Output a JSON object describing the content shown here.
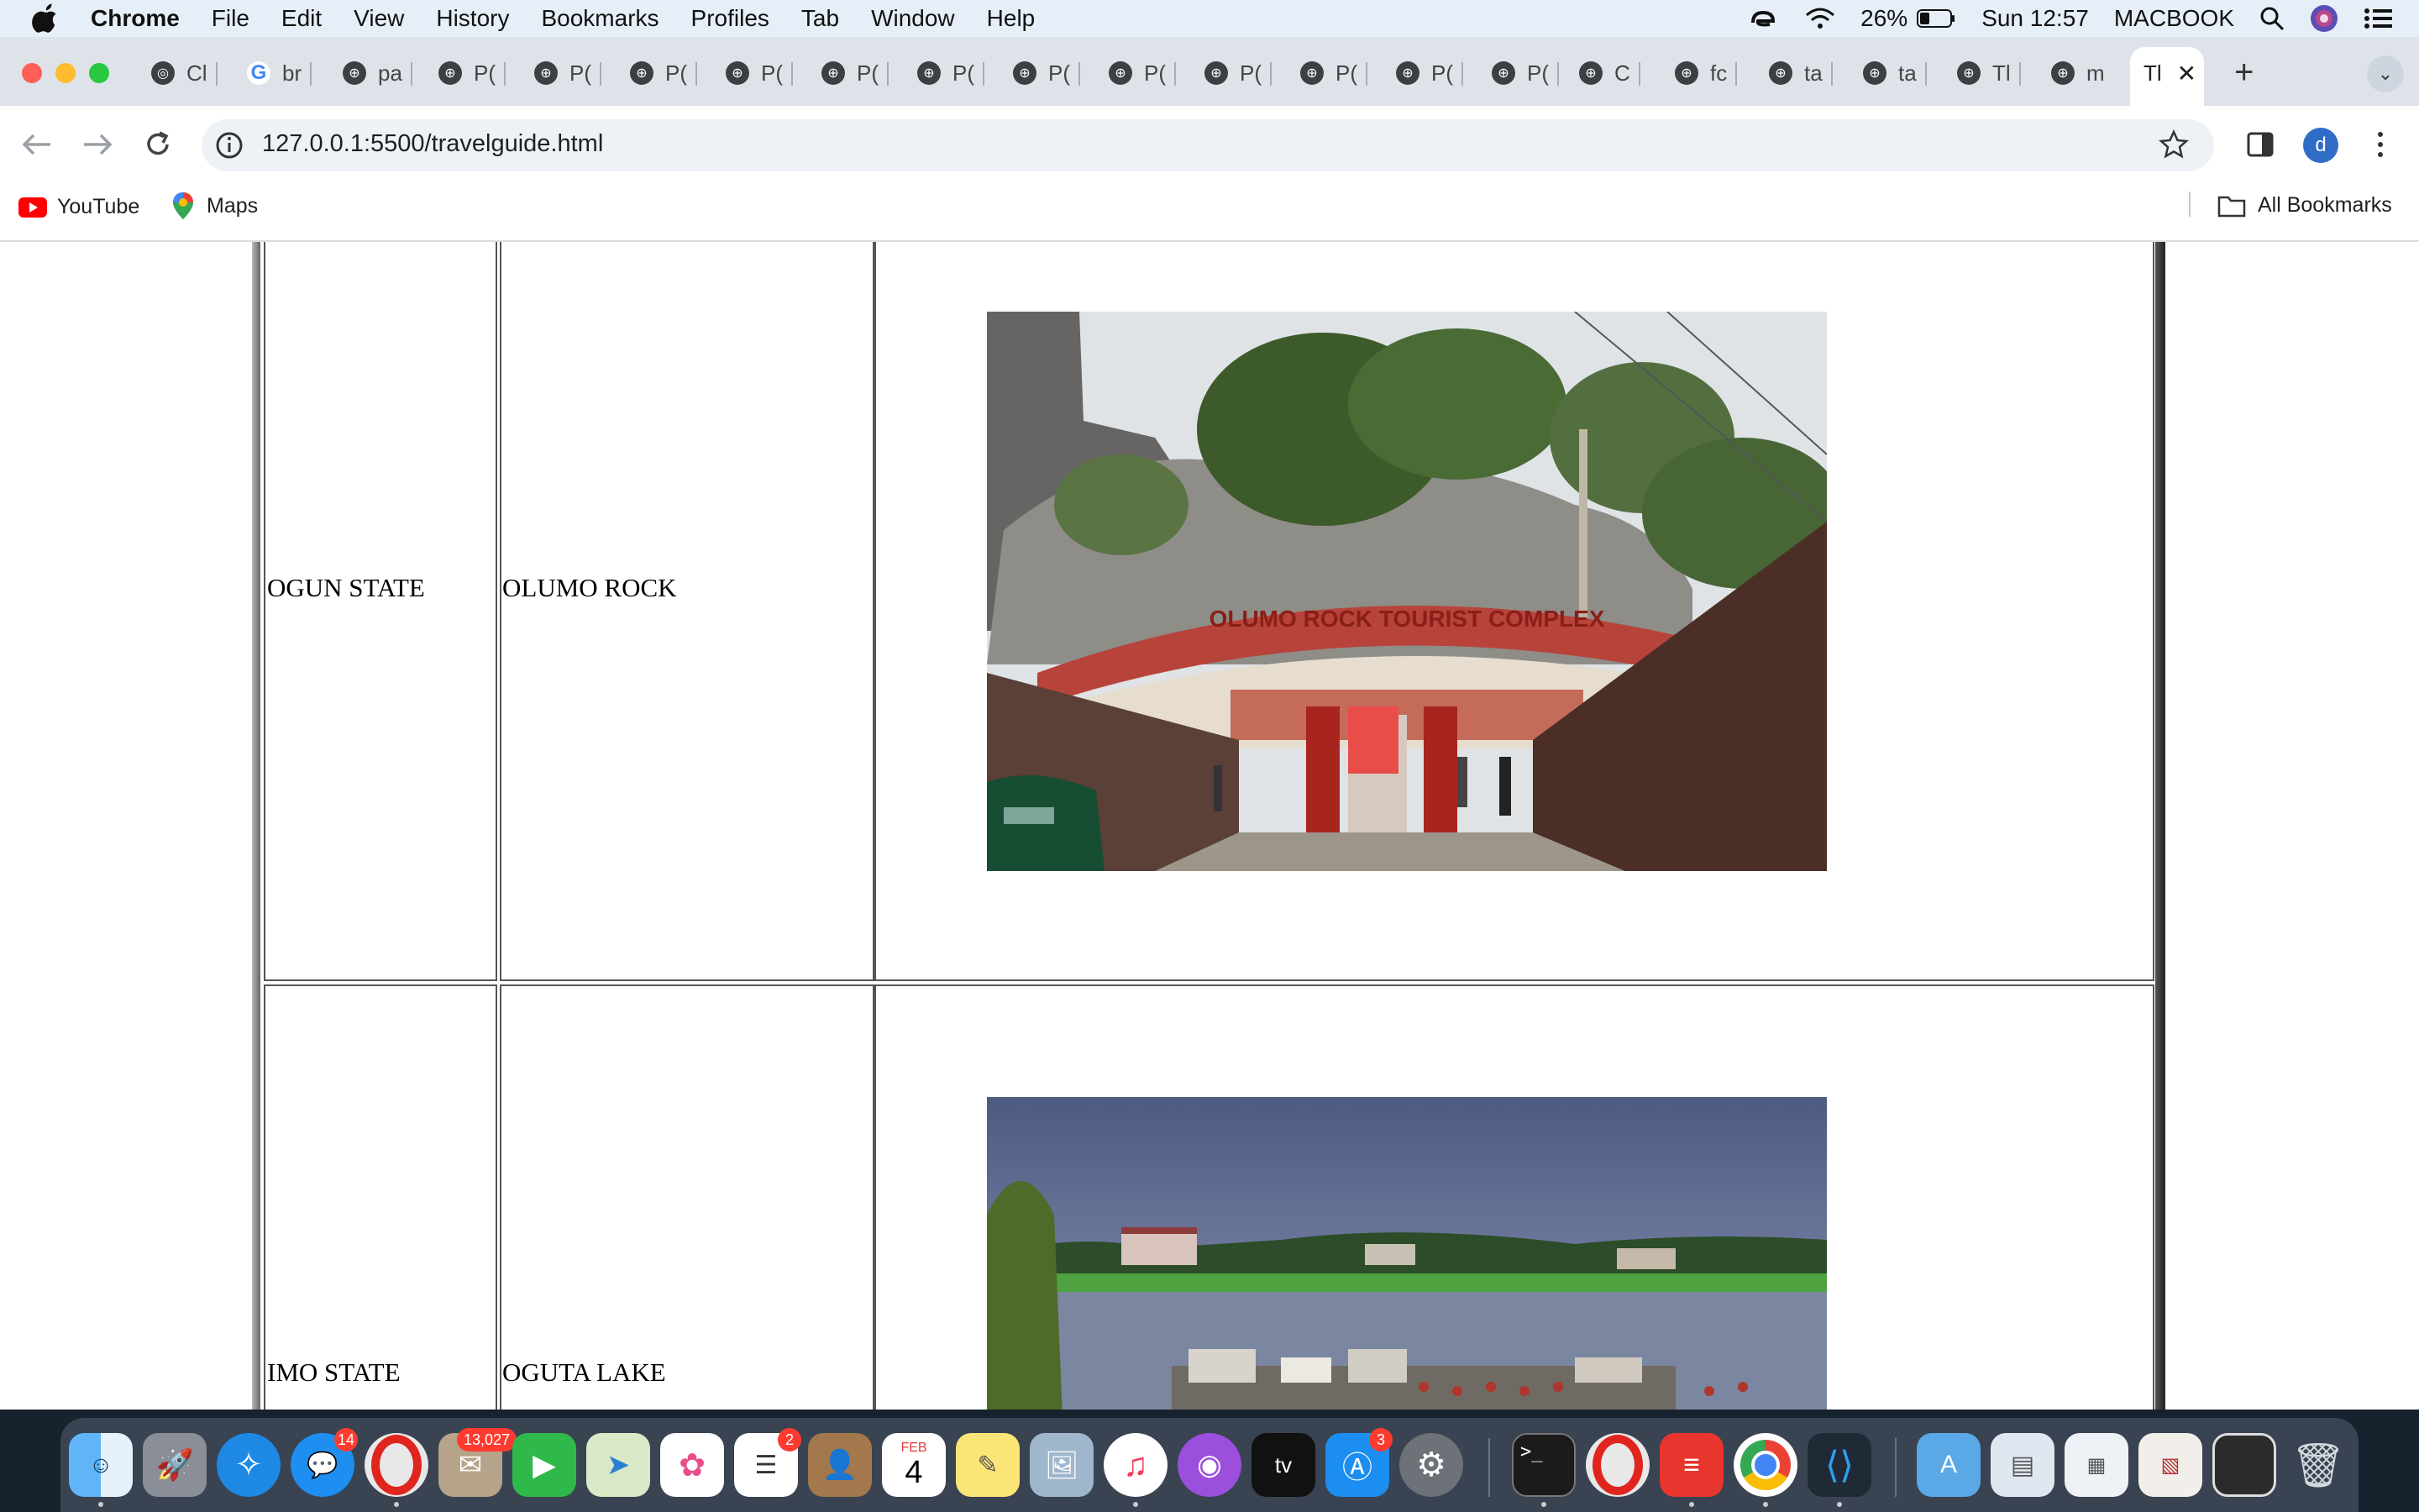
{
  "menubar": {
    "app_name": "Chrome",
    "items": [
      "File",
      "Edit",
      "View",
      "History",
      "Bookmarks",
      "Profiles",
      "Tab",
      "Window",
      "Help"
    ],
    "battery": "26%",
    "datetime": "Sun 12:57",
    "username": "MACBOOK"
  },
  "tabs": [
    "Cl",
    "br",
    "pa",
    "P(",
    "P(",
    "P(",
    "P(",
    "P(",
    "P(",
    "P(",
    "P(",
    "P(",
    "P(",
    "P(",
    "P(",
    "C",
    "fc",
    "ta",
    "ta",
    "Tl",
    "m",
    "Tl"
  ],
  "toolbar": {
    "url": "127.0.0.1:5500/travelguide.html",
    "profile_initial": "d"
  },
  "bookmarks": {
    "items": [
      "YouTube",
      "Maps"
    ],
    "all_bookmarks": "All Bookmarks"
  },
  "table": {
    "rows": [
      {
        "state": "OGUN STATE",
        "place": "OLUMO ROCK",
        "image": "Olumo Rock tourist complex gate photo",
        "sign_text": "OLUMO ROCK TOURIST COMPLEX"
      },
      {
        "state": "IMO STATE",
        "place": "OGUTA LAKE",
        "image": "Oguta Lake shoreline photo"
      }
    ]
  },
  "dock": {
    "badges": {
      "messages": "14",
      "mail": "13,027",
      "reminders": "2",
      "appstore": "3"
    },
    "calendar": {
      "month": "FEB",
      "day": "4"
    },
    "tv_label": "tv"
  }
}
